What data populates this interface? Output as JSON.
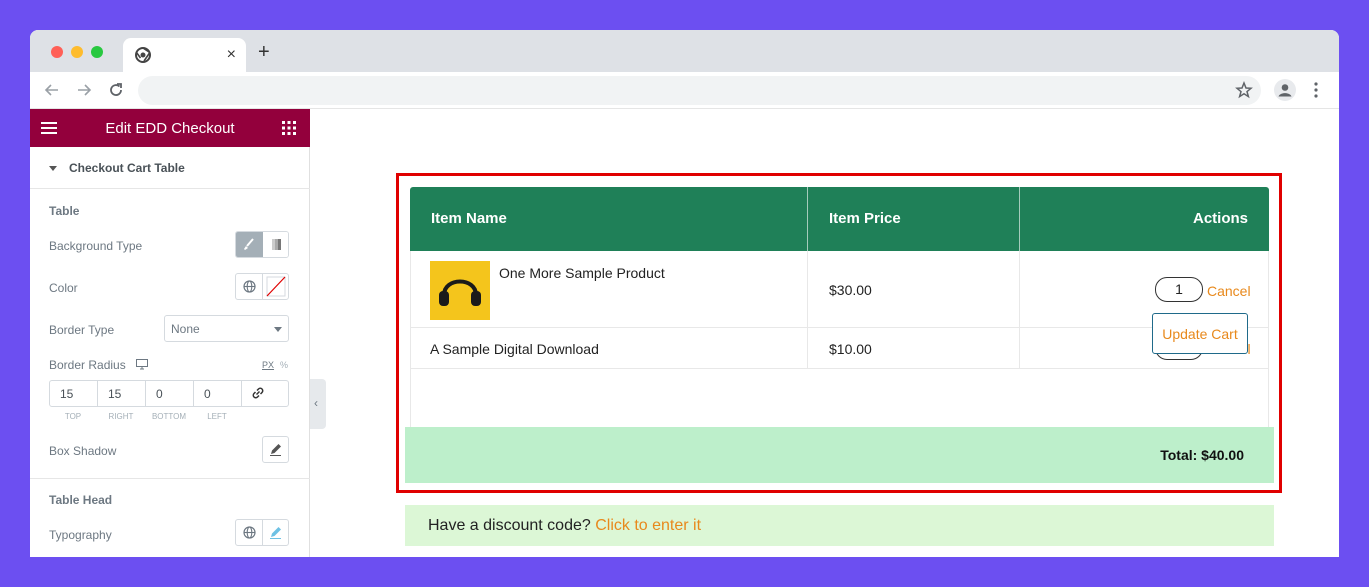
{
  "browser": {
    "tab_close": "×",
    "new_tab": "+"
  },
  "panel": {
    "title": "Edit EDD Checkout",
    "section": "Checkout Cart Table",
    "group_table": "Table",
    "background_type_label": "Background Type",
    "color_label": "Color",
    "border_type_label": "Border Type",
    "border_type_value": "None",
    "border_radius_label": "Border Radius",
    "unit_px": "PX",
    "unit_pct": "%",
    "radius": {
      "top": "15",
      "right": "15",
      "bottom": "0",
      "left": "0"
    },
    "radius_labels": {
      "top": "TOP",
      "right": "RIGHT",
      "bottom": "BOTTOM",
      "left": "LEFT"
    },
    "box_shadow_label": "Box Shadow",
    "group_table_head": "Table Head",
    "typography_label": "Typography",
    "collapse": "‹"
  },
  "cart": {
    "headers": {
      "name": "Item Name",
      "price": "Item Price",
      "actions": "Actions"
    },
    "items": [
      {
        "name": "One More Sample Product",
        "price": "$30.00",
        "qty": "1",
        "cancel": "Cancel"
      },
      {
        "name": "A Sample Digital Download",
        "price": "$10.00",
        "qty": "1",
        "cancel": "Cancel"
      }
    ],
    "update_label": "Update Cart",
    "total": "Total: $40.00",
    "discount_prompt": "Have a discount code?",
    "discount_link": "Click to enter it"
  },
  "colors": {
    "panel_header": "#93003c",
    "table_header": "#1f8058",
    "accent": "#e8891c",
    "total_bg": "#bdefcb",
    "discount_bg": "#dcf7d6",
    "highlight": "#e00000"
  }
}
